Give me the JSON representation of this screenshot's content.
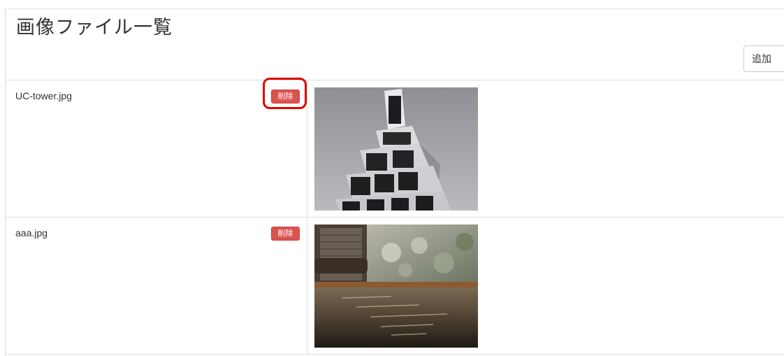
{
  "page": {
    "title": "画像ファイル一覧",
    "add_label": "追加"
  },
  "files": [
    {
      "name": "UC-tower.jpg",
      "delete_label": "削除",
      "highlighted": true,
      "image": "rendered-tower-of-white-frames"
    },
    {
      "name": "aaa.jpg",
      "delete_label": "削除",
      "highlighted": false,
      "image": "hot-spring-bath-water"
    }
  ],
  "colors": {
    "delete_button": "#d9534f",
    "highlight_border": "#e00000",
    "table_border": "#dddddd"
  }
}
